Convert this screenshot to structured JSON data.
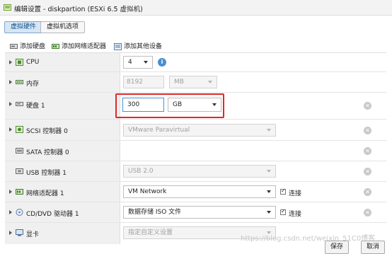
{
  "window": {
    "title": "编辑设置 - diskpartion (ESXi 6.5 虚拟机)"
  },
  "tabs": [
    {
      "label": "虚拟硬件",
      "active": true
    },
    {
      "label": "虚拟机选项",
      "active": false
    }
  ],
  "toolbar": {
    "add_disk": "添加硬盘",
    "add_network": "添加网络适配器",
    "add_other": "添加其他设备"
  },
  "devices": {
    "cpu": {
      "label": "CPU",
      "value": "4",
      "info_icon": "info-icon"
    },
    "memory": {
      "label": "内存",
      "value": "8192",
      "unit": "MB"
    },
    "disk": {
      "label": "硬盘 1",
      "value": "300",
      "unit": "GB"
    },
    "scsi": {
      "label": "SCSI 控制器 0",
      "value": "VMware Paravirtual"
    },
    "sata": {
      "label": "SATA 控制器 0"
    },
    "usb": {
      "label": "USB 控制器 1",
      "value": "USB 2.0"
    },
    "network": {
      "label": "网络适配器 1",
      "value": "VM Network",
      "connect_label": "连接",
      "connected": true
    },
    "cdrom": {
      "label": "CD/DVD 驱动器 1",
      "value": "数据存储 ISO 文件",
      "connect_label": "连接",
      "connected": true
    },
    "video": {
      "label": "显卡",
      "value": "指定自定义设置"
    }
  },
  "remove_glyph": "✕",
  "buttons": {
    "save": "保存",
    "cancel": "取消"
  },
  "watermark": "https://blog.csdn.net/weixin_51C0博客",
  "colors": {
    "highlight": "#e02727",
    "info": "#4a8fd1",
    "active_tab": "#d7e6f5"
  }
}
